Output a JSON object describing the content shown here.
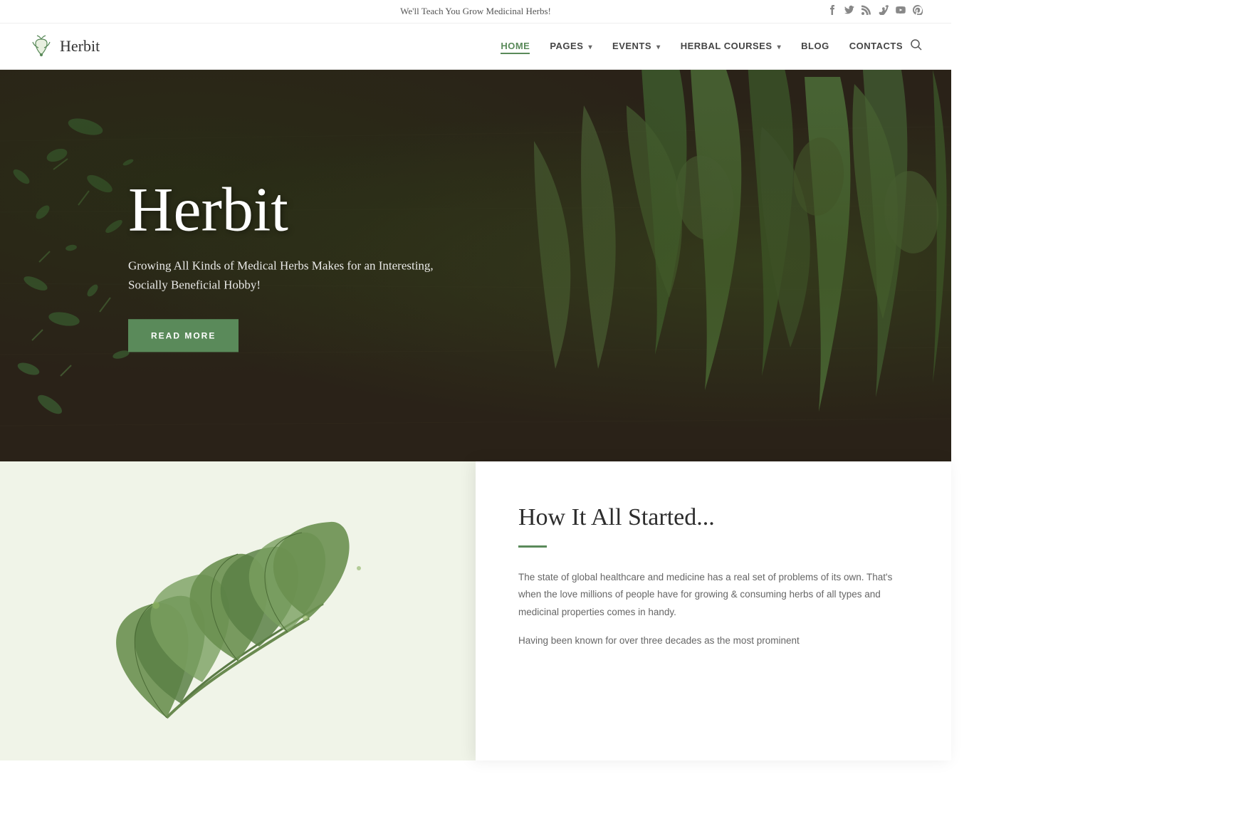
{
  "topbar": {
    "tagline": "We'll Teach You Grow Medicinal Herbs!",
    "social_icons": [
      "f",
      "t",
      "rss",
      "v",
      "yt",
      "p"
    ]
  },
  "nav": {
    "logo_text": "Herbit",
    "links": [
      {
        "label": "HOME",
        "active": true,
        "has_dropdown": false
      },
      {
        "label": "PAGES",
        "active": false,
        "has_dropdown": true
      },
      {
        "label": "EVENTS",
        "active": false,
        "has_dropdown": true
      },
      {
        "label": "HERBAL COURSES",
        "active": false,
        "has_dropdown": true
      },
      {
        "label": "BLOG",
        "active": false,
        "has_dropdown": false
      },
      {
        "label": "CONTACTS",
        "active": false,
        "has_dropdown": false
      }
    ]
  },
  "hero": {
    "title": "Herbit",
    "subtitle": "Growing All Kinds of Medical Herbs Makes for an Interesting, Socially Beneficial Hobby!",
    "button_label": "READ MORE"
  },
  "about": {
    "heading": "How It All Started...",
    "paragraph1": "The state of global healthcare and medicine has a real set of problems of its own. That's when the love millions of people have for growing & consuming herbs of all types and medicinal properties comes in handy.",
    "paragraph2": "Having been known for over three decades as the most prominent"
  }
}
